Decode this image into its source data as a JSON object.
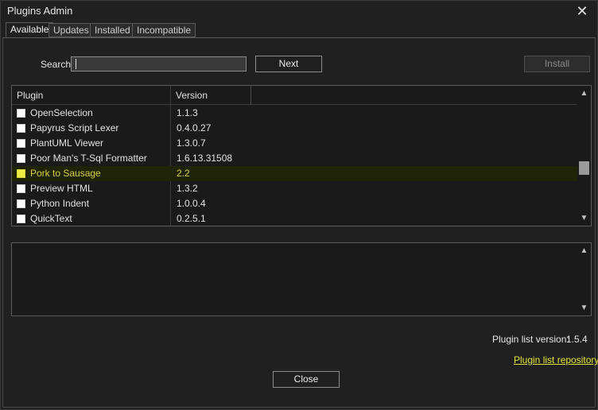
{
  "window": {
    "title": "Plugins Admin",
    "close_glyph": "✕"
  },
  "tabs": [
    {
      "label": "Available",
      "active": true
    },
    {
      "label": "Updates",
      "active": false
    },
    {
      "label": "Installed",
      "active": false
    },
    {
      "label": "Incompatible",
      "active": false
    }
  ],
  "search": {
    "label": "Search:",
    "value": ""
  },
  "buttons": {
    "next": "Next",
    "install": "Install",
    "close": "Close"
  },
  "list": {
    "columns": [
      "Plugin",
      "Version"
    ],
    "rows": [
      {
        "name": "OpenSelection",
        "version": "1.1.3",
        "checked": false,
        "selected": false
      },
      {
        "name": "Papyrus Script Lexer",
        "version": "0.4.0.27",
        "checked": false,
        "selected": false
      },
      {
        "name": "PlantUML Viewer",
        "version": "1.3.0.7",
        "checked": false,
        "selected": false
      },
      {
        "name": "Poor Man's T-Sql Formatter",
        "version": "1.6.13.31508",
        "checked": false,
        "selected": false
      },
      {
        "name": "Pork to Sausage",
        "version": "2.2",
        "checked": false,
        "selected": true
      },
      {
        "name": "Preview HTML",
        "version": "1.3.2",
        "checked": false,
        "selected": false
      },
      {
        "name": "Python Indent",
        "version": "1.0.0.4",
        "checked": false,
        "selected": false
      },
      {
        "name": "QuickText",
        "version": "0.2.5.1",
        "checked": false,
        "selected": false
      }
    ],
    "scroll_position": 0.62
  },
  "description": {
    "text": ""
  },
  "footer": {
    "list_version_label": "Plugin list version:",
    "list_version_value": "1.5.4",
    "repo_link": "Plugin list repository"
  },
  "colors": {
    "background": "#202020",
    "highlight": "#d7d23c",
    "link": "#e6e63a"
  }
}
